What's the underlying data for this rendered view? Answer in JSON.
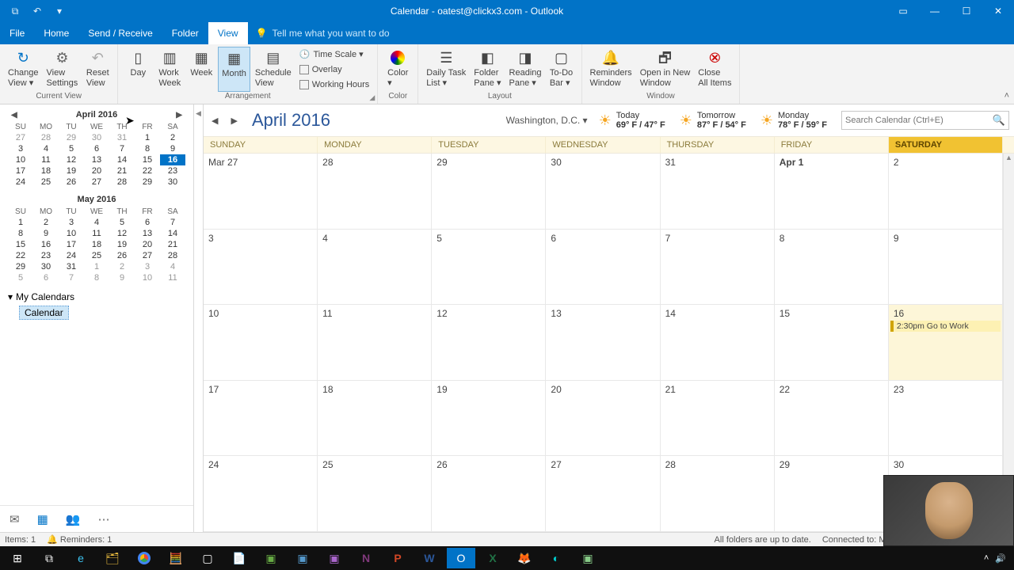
{
  "app_title": "Calendar - oatest@clickx3.com - Outlook",
  "tabs": {
    "file": "File",
    "home": "Home",
    "sendreceive": "Send / Receive",
    "folder": "Folder",
    "view": "View",
    "tellme": "Tell me what you want to do"
  },
  "ribbon": {
    "change_view": "Change\nView ▾",
    "view_settings": "View\nSettings",
    "reset_view": "Reset\nView",
    "group_currentview": "Current View",
    "day": "Day",
    "work_week": "Work\nWeek",
    "week": "Week",
    "month": "Month",
    "schedule_view": "Schedule\nView",
    "time_scale": "Time Scale ▾",
    "overlay": "Overlay",
    "working_hours": "Working Hours",
    "group_arrangement": "Arrangement",
    "color": "Color\n▾",
    "group_color": "Color",
    "daily_task": "Daily Task\nList ▾",
    "folder_pane": "Folder\nPane ▾",
    "reading_pane": "Reading\nPane ▾",
    "todo_bar": "To-Do\nBar ▾",
    "group_layout": "Layout",
    "reminders_window": "Reminders\nWindow",
    "open_new": "Open in New\nWindow",
    "close_all": "Close\nAll Items",
    "group_window": "Window"
  },
  "mini1": {
    "title": "April 2016",
    "dow": [
      "SU",
      "MO",
      "TU",
      "WE",
      "TH",
      "FR",
      "SA"
    ],
    "rows": [
      [
        "27",
        "28",
        "29",
        "30",
        "31",
        "1",
        "2"
      ],
      [
        "3",
        "4",
        "5",
        "6",
        "7",
        "8",
        "9"
      ],
      [
        "10",
        "11",
        "12",
        "13",
        "14",
        "15",
        "16"
      ],
      [
        "17",
        "18",
        "19",
        "20",
        "21",
        "22",
        "23"
      ],
      [
        "24",
        "25",
        "26",
        "27",
        "28",
        "29",
        "30"
      ]
    ],
    "today": "16"
  },
  "mini2": {
    "title": "May 2016",
    "dow": [
      "SU",
      "MO",
      "TU",
      "WE",
      "TH",
      "FR",
      "SA"
    ],
    "rows": [
      [
        "1",
        "2",
        "3",
        "4",
        "5",
        "6",
        "7"
      ],
      [
        "8",
        "9",
        "10",
        "11",
        "12",
        "13",
        "14"
      ],
      [
        "15",
        "16",
        "17",
        "18",
        "19",
        "20",
        "21"
      ],
      [
        "22",
        "23",
        "24",
        "25",
        "26",
        "27",
        "28"
      ],
      [
        "29",
        "30",
        "31",
        "1",
        "2",
        "3",
        "4"
      ],
      [
        "5",
        "6",
        "7",
        "8",
        "9",
        "10",
        "11"
      ]
    ]
  },
  "mycalendars": {
    "header": "My Calendars",
    "item": "Calendar"
  },
  "big_month": "April 2016",
  "location": "Washington,  D.C. ▾",
  "weather": [
    {
      "label": "Today",
      "temp": "69° F / 47° F"
    },
    {
      "label": "Tomorrow",
      "temp": "87° F / 54° F"
    },
    {
      "label": "Monday",
      "temp": "78° F / 59° F"
    }
  ],
  "search_placeholder": "Search Calendar (Ctrl+E)",
  "dayheaders": [
    "SUNDAY",
    "MONDAY",
    "TUESDAY",
    "WEDNESDAY",
    "THURSDAY",
    "FRIDAY",
    "SATURDAY"
  ],
  "grid": [
    [
      {
        "n": "Mar 27"
      },
      {
        "n": "28"
      },
      {
        "n": "29"
      },
      {
        "n": "30"
      },
      {
        "n": "31"
      },
      {
        "n": "Apr 1",
        "bold": true
      },
      {
        "n": "2"
      }
    ],
    [
      {
        "n": "3"
      },
      {
        "n": "4"
      },
      {
        "n": "5"
      },
      {
        "n": "6"
      },
      {
        "n": "7"
      },
      {
        "n": "8"
      },
      {
        "n": "9"
      }
    ],
    [
      {
        "n": "10"
      },
      {
        "n": "11"
      },
      {
        "n": "12"
      },
      {
        "n": "13"
      },
      {
        "n": "14"
      },
      {
        "n": "15"
      },
      {
        "n": "16",
        "today": true,
        "event": "2:30pm Go to Work"
      }
    ],
    [
      {
        "n": "17"
      },
      {
        "n": "18"
      },
      {
        "n": "19"
      },
      {
        "n": "20"
      },
      {
        "n": "21"
      },
      {
        "n": "22"
      },
      {
        "n": "23"
      }
    ],
    [
      {
        "n": "24"
      },
      {
        "n": "25"
      },
      {
        "n": "26"
      },
      {
        "n": "27"
      },
      {
        "n": "28"
      },
      {
        "n": "29"
      },
      {
        "n": "30"
      }
    ]
  ],
  "status": {
    "items": "Items: 1",
    "reminders": "Reminders: 1",
    "sync": "All folders are up to date.",
    "conn": "Connected to: Microsoft Exchange"
  }
}
